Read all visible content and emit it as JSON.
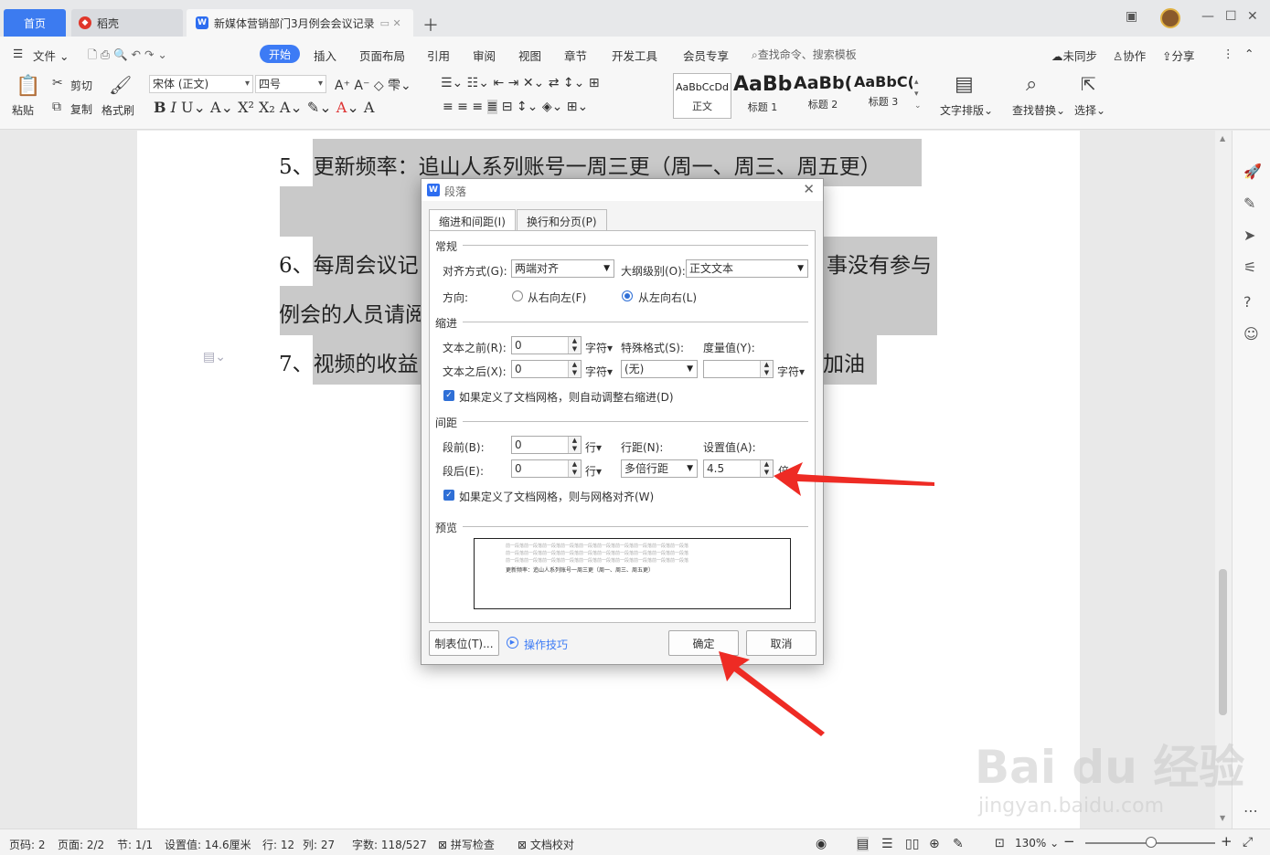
{
  "tabs": {
    "home": "首页",
    "daoke": "稻壳",
    "doc": "新媒体营销部门3月例会会议记录"
  },
  "menu": {
    "file": "文件",
    "start": "开始",
    "insert": "插入",
    "layout": "页面布局",
    "reference": "引用",
    "review": "审阅",
    "view": "视图",
    "chapter": "章节",
    "devtools": "开发工具",
    "member": "会员专享",
    "search": "查找命令、搜索模板",
    "unsynced": "未同步",
    "collab": "协作",
    "share": "分享"
  },
  "ribbon": {
    "paste": "粘贴",
    "cut": "剪切",
    "copy": "复制",
    "format_painter": "格式刷",
    "font_name": "宋体 (正文)",
    "font_size": "四号",
    "styles": [
      {
        "sample": "AaBbCcDd",
        "label": "正文"
      },
      {
        "sample": "AaBb",
        "label": "标题 1"
      },
      {
        "sample": "AaBb(",
        "label": "标题 2"
      },
      {
        "sample": "AaBbC(",
        "label": "标题 3"
      }
    ],
    "text_layout": "文字排版",
    "find_replace": "查找替换",
    "select": "选择"
  },
  "document": {
    "line5": "5、更新频率：追山人系列账号一周三更（周一、周三、周五更）",
    "line6_start": "6、每周会议记",
    "line6_end": "事没有参与",
    "line6b": "例会的人员请阅",
    "line7_start": "7、视频的收益",
    "line7_end": "加油"
  },
  "dialog": {
    "title": "段落",
    "tab_indent": "缩进和间距(I)",
    "tab_break": "换行和分页(P)",
    "sec_general": "常规",
    "align_label": "对齐方式(G):",
    "align_value": "两端对齐",
    "outline_label": "大纲级别(O):",
    "outline_value": "正文文本",
    "direction_label": "方向:",
    "rtl": "从右向左(F)",
    "ltr": "从左向右(L)",
    "sec_indent": "缩进",
    "before_text_label": "文本之前(R):",
    "before_text_value": "0",
    "after_text_label": "文本之后(X):",
    "after_text_value": "0",
    "unit_char": "字符",
    "special_label": "特殊格式(S):",
    "special_value": "(无)",
    "measure_label": "度量值(Y):",
    "measure_value": "",
    "auto_indent": "如果定义了文档网格，则自动调整右缩进(D)",
    "sec_spacing": "间距",
    "before_label": "段前(B):",
    "before_value": "0",
    "after_label": "段后(E):",
    "after_value": "0",
    "unit_line": "行",
    "line_spacing_label": "行距(N):",
    "line_spacing_value": "多倍行距",
    "set_value_label": "设置值(A):",
    "set_value": "4.5",
    "unit_times": "倍",
    "grid_align": "如果定义了文档网格，则与网格对齐(W)",
    "sec_preview": "预览",
    "preview_prev": "前一段落前一段落前一段落前一段落前一段落前一段落前一段落前一段落前一段落前一段落",
    "preview_text": "更新频率：追山人系列账号一周三更（周一、周三、周五更）",
    "tabs_button": "制表位(T)...",
    "tips": "操作技巧",
    "ok": "确定",
    "cancel": "取消"
  },
  "status": {
    "page": "页码: 2",
    "pages": "页面: 2/2",
    "section": "节: 1/1",
    "setting": "设置值: 14.6厘米",
    "row": "行: 12",
    "col": "列: 27",
    "words": "字数: 118/527",
    "spell": "拼写检查",
    "proof": "文档校对",
    "zoom": "130%"
  },
  "watermark": {
    "main": "Bai du 经验",
    "sub": "jingyan.baidu.com"
  },
  "colors": {
    "accent": "#3d7bf5",
    "highlight": "#c9c9c9",
    "arrow": "#ee2b24"
  }
}
